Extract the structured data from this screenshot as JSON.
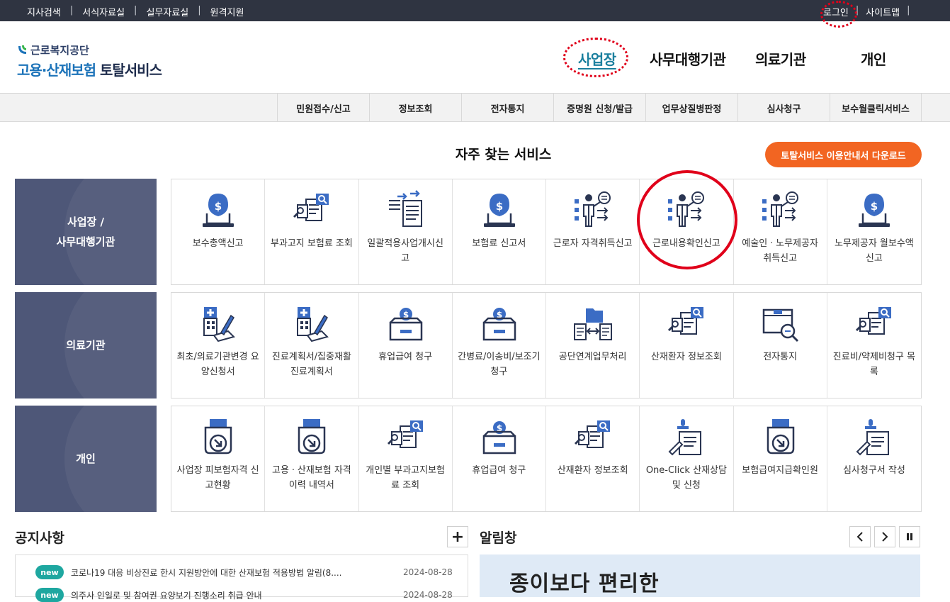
{
  "topbar": {
    "left": [
      "지사검색",
      "서식자료실",
      "실무자료실",
      "원격지원"
    ],
    "right": [
      "로그인",
      "사이트맵"
    ]
  },
  "logo": {
    "org": "근로복지공단",
    "service_a": "고용·산재보험",
    "service_b": "토탈서비스"
  },
  "gnb": [
    "사업장",
    "사무대행기관",
    "의료기관",
    "개인"
  ],
  "subnav": [
    "민원접수/신고",
    "정보조회",
    "전자통지",
    "증명원 신청/발급",
    "업무상질병판정",
    "심사청구",
    "보수월클릭서비스"
  ],
  "frequent": {
    "title": "자주 찾는 서비스",
    "download": "토탈서비스 이용안내서 다운로드"
  },
  "rows": [
    {
      "category": "사업장 /\n사무대행기관",
      "tiles": [
        {
          "label": "보수총액신고",
          "icon": "money-laptop-icon"
        },
        {
          "label": "부과고지 보험료 조회",
          "icon": "document-search-icon"
        },
        {
          "label": "일괄적용사업개시신고",
          "icon": "document-transfer-icon"
        },
        {
          "label": "보험료 신고서",
          "icon": "money-laptop-icon"
        },
        {
          "label": "근로자 자격취득신고",
          "icon": "worker-board-icon"
        },
        {
          "label": "근로내용확인신고",
          "icon": "worker-board-icon"
        },
        {
          "label": "예술인ㆍ노무제공자 취득신고",
          "icon": "worker-board-icon"
        },
        {
          "label": "노무제공자 월보수액 신고",
          "icon": "money-laptop-icon"
        }
      ]
    },
    {
      "category": "의료기관",
      "tiles": [
        {
          "label": "최초/의료기관변경 요양신청서",
          "icon": "hospital-pen-icon"
        },
        {
          "label": "진료계획서/집중재활진료계획서",
          "icon": "hospital-pen-icon"
        },
        {
          "label": "휴업급여 청구",
          "icon": "coin-box-icon"
        },
        {
          "label": "간병료/이송비/보조기 청구",
          "icon": "coin-box-icon"
        },
        {
          "label": "공단연계업무처리",
          "icon": "folder-exchange-icon"
        },
        {
          "label": "산재환자 정보조회",
          "icon": "document-search-icon"
        },
        {
          "label": "전자통지",
          "icon": "box-magnifier-icon"
        },
        {
          "label": "진료비/약제비청구 목록",
          "icon": "document-search-icon"
        }
      ]
    },
    {
      "category": "개인",
      "tiles": [
        {
          "label": "사업장 피보험자격 신고현황",
          "icon": "printer-arrow-icon"
        },
        {
          "label": "고용ㆍ산재보험 자격 이력 내역서",
          "icon": "printer-arrow-icon"
        },
        {
          "label": "개인별 부과고지보험료 조회",
          "icon": "document-search-icon"
        },
        {
          "label": "휴업급여 청구",
          "icon": "coin-box-icon"
        },
        {
          "label": "산재환자 정보조회",
          "icon": "document-search-icon"
        },
        {
          "label": "One-Click 산재상담 및 신청",
          "icon": "stamp-document-icon"
        },
        {
          "label": "보험급여지급확인원",
          "icon": "printer-arrow-icon"
        },
        {
          "label": "심사청구서 작성",
          "icon": "stamp-document-icon"
        }
      ]
    }
  ],
  "notice": {
    "title": "공지사항",
    "more": "+",
    "items": [
      {
        "badge": "new",
        "text": "코로나19 대응 비상진료 한시 지원방안에 대한 산재보험 적용방법 알림(8....",
        "date": "2024-08-28"
      },
      {
        "badge": "new",
        "text": "의주사 인일로 및 참여권 요양보기 진행소리 취급 안내",
        "date": "2024-08-28"
      }
    ]
  },
  "alarm": {
    "title": "알림창",
    "prev": "<",
    "next": ">",
    "pause": "II",
    "banner_text": "종이보다 편리한"
  },
  "colors": {
    "topbar": "#2f3441",
    "category": "#4e5778",
    "accent": "#f26522",
    "icon_blue": "#3b6cc4",
    "icon_dark": "#2a3552",
    "annotation": "#e0001a"
  }
}
